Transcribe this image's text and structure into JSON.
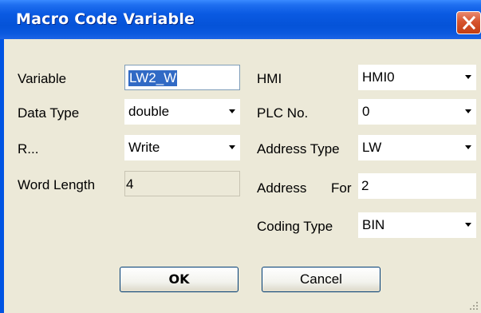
{
  "window": {
    "title": "Macro Code Variable"
  },
  "form": {
    "variable_label": "Variable",
    "variable_value": "LW2_W",
    "datatype_label": "Data Type",
    "datatype_value": "double",
    "rw_label": "R...",
    "rw_value": "Write",
    "wordlength_label": "Word Length",
    "wordlength_value": "4",
    "hmi_label": "HMI",
    "hmi_value": "HMI0",
    "plcno_label": "PLC No.",
    "plcno_value": "0",
    "addresstype_label": "Address Type",
    "addresstype_value": "LW",
    "address_label": "Address",
    "address_format_label": "For",
    "address_value": "2",
    "codingtype_label": "Coding Type",
    "codingtype_value": "BIN"
  },
  "buttons": {
    "ok": "OK",
    "cancel": "Cancel"
  },
  "icons": {
    "close": "close-x-icon",
    "dropdown": "triangle-down-icon",
    "grip": "resize-grip-icon"
  }
}
